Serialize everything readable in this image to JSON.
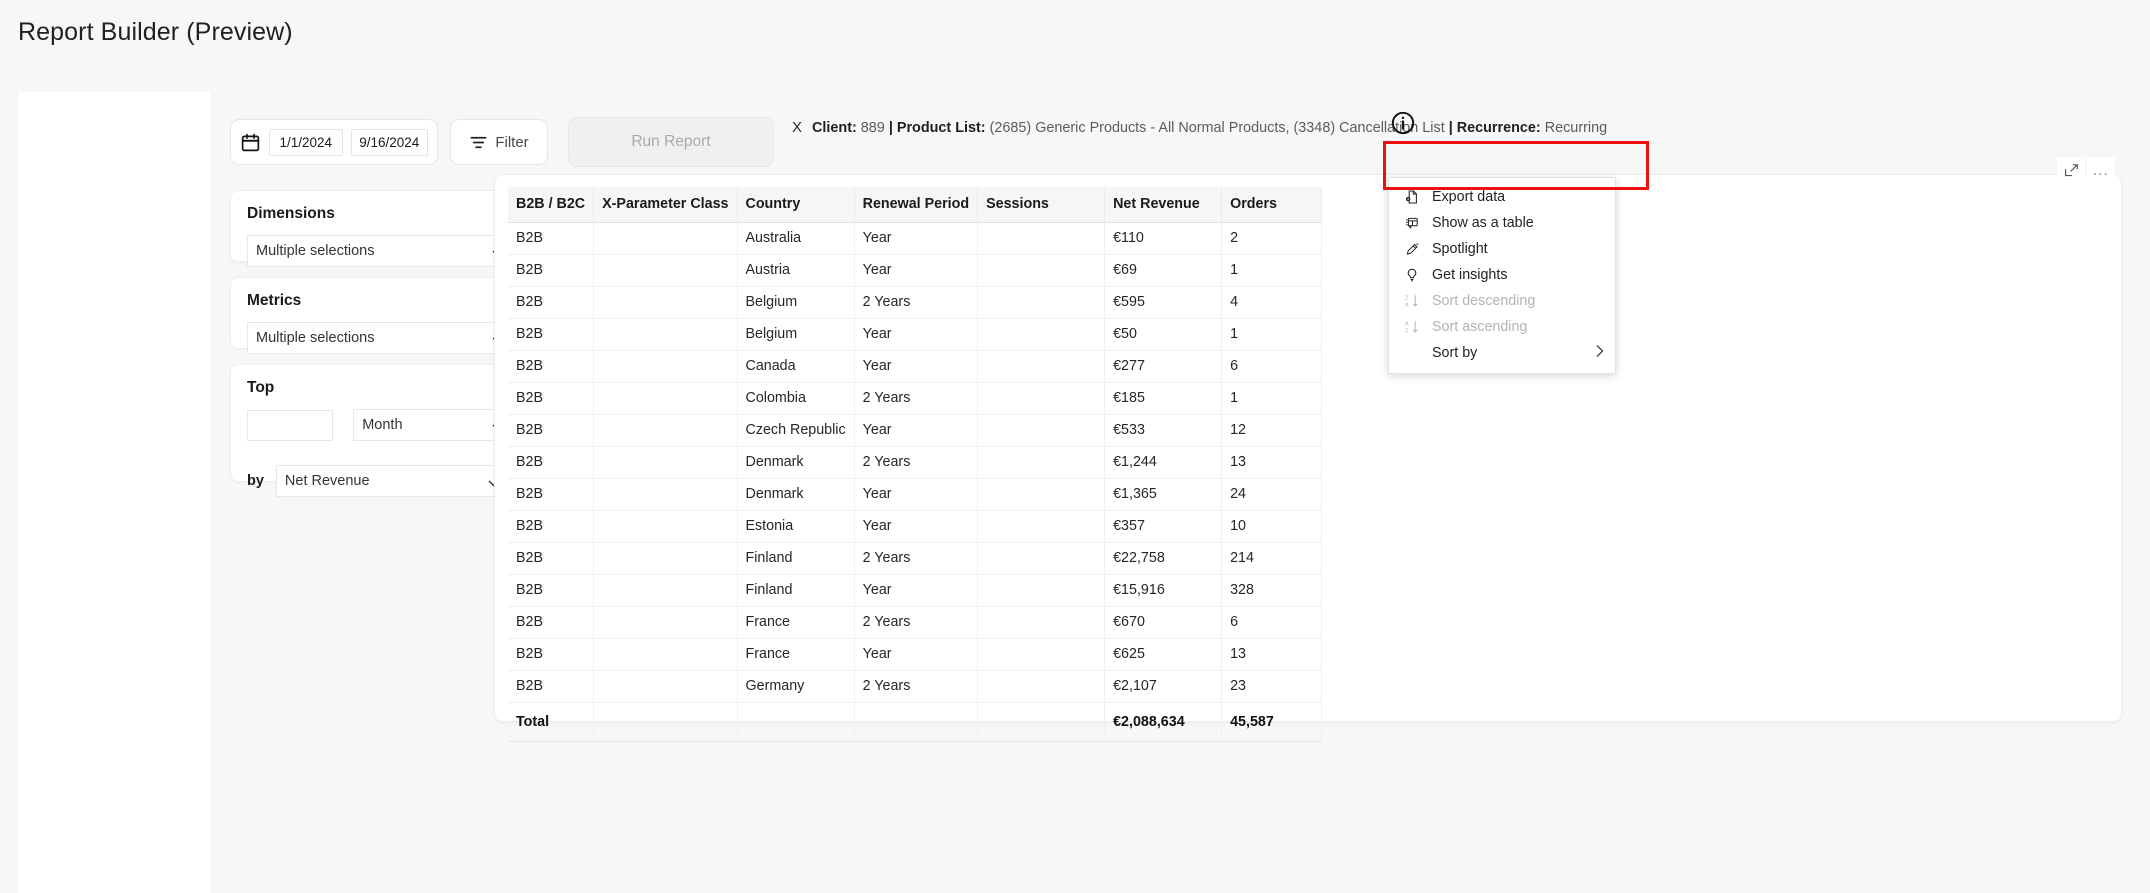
{
  "header": {
    "title": "Report Builder (Preview)"
  },
  "toolbar": {
    "calendar_icon": "calendar-icon",
    "date_from": "1/1/2024",
    "date_to": "9/16/2024",
    "filter_label": "Filter",
    "filter_icon": "filter-icon",
    "run_report_label": "Run Report",
    "info_icon": "info-circle-icon",
    "applied_filters": {
      "remove_label": "X",
      "client_label": "Client:",
      "client_value": "889",
      "sep1": "|",
      "product_list_label": "Product List:",
      "product_list_value": "(2685) Generic Products - All Normal Products, (3348) Cancellation List",
      "sep2": "|",
      "recurrence_label": "Recurrence:",
      "recurrence_value": "Recurring"
    }
  },
  "config": {
    "dimensions": {
      "title": "Dimensions",
      "value": "Multiple selections"
    },
    "metrics": {
      "title": "Metrics",
      "value": "Multiple selections"
    },
    "top": {
      "title": "Top",
      "count_value": "",
      "period_value": "Month",
      "by_label": "by",
      "by_value": "Net Revenue"
    }
  },
  "visual": {
    "focus_icon": "focus-mode-icon",
    "more_options_icon": "more-options-ellipsis-icon",
    "columns": [
      "B2B / B2C",
      "X-Parameter Class",
      "Country",
      "Renewal Period",
      "Sessions",
      "Net Revenue",
      "Orders"
    ],
    "rows": [
      [
        "B2B",
        "",
        "Australia",
        "Year",
        "",
        "€110",
        "2"
      ],
      [
        "B2B",
        "",
        "Austria",
        "Year",
        "",
        "€69",
        "1"
      ],
      [
        "B2B",
        "",
        "Belgium",
        "2 Years",
        "",
        "€595",
        "4"
      ],
      [
        "B2B",
        "",
        "Belgium",
        "Year",
        "",
        "€50",
        "1"
      ],
      [
        "B2B",
        "",
        "Canada",
        "Year",
        "",
        "€277",
        "6"
      ],
      [
        "B2B",
        "",
        "Colombia",
        "2 Years",
        "",
        "€185",
        "1"
      ],
      [
        "B2B",
        "",
        "Czech Republic",
        "Year",
        "",
        "€533",
        "12"
      ],
      [
        "B2B",
        "",
        "Denmark",
        "2 Years",
        "",
        "€1,244",
        "13"
      ],
      [
        "B2B",
        "",
        "Denmark",
        "Year",
        "",
        "€1,365",
        "24"
      ],
      [
        "B2B",
        "",
        "Estonia",
        "Year",
        "",
        "€357",
        "10"
      ],
      [
        "B2B",
        "",
        "Finland",
        "2 Years",
        "",
        "€22,758",
        "214"
      ],
      [
        "B2B",
        "",
        "Finland",
        "Year",
        "",
        "€15,916",
        "328"
      ],
      [
        "B2B",
        "",
        "France",
        "2 Years",
        "",
        "€670",
        "6"
      ],
      [
        "B2B",
        "",
        "France",
        "Year",
        "",
        "€625",
        "13"
      ],
      [
        "B2B",
        "",
        "Germany",
        "2 Years",
        "",
        "€2,107",
        "23"
      ]
    ],
    "total_row": [
      "Total",
      "",
      "",
      "",
      "",
      "€2,088,634",
      "45,587"
    ]
  },
  "context_menu": {
    "items": [
      {
        "label": "Export data",
        "icon": "export-data-icon",
        "disabled": false,
        "highlighted": true
      },
      {
        "label": "Show as a table",
        "icon": "show-as-table-icon",
        "disabled": false,
        "highlighted": false
      },
      {
        "label": "Spotlight",
        "icon": "spotlight-icon",
        "disabled": false,
        "highlighted": false
      },
      {
        "label": "Get insights",
        "icon": "lightbulb-icon",
        "disabled": false,
        "highlighted": false
      },
      {
        "label": "Sort descending",
        "icon": "sort-descending-icon",
        "disabled": true,
        "highlighted": false
      },
      {
        "label": "Sort ascending",
        "icon": "sort-ascending-icon",
        "disabled": true,
        "highlighted": false
      },
      {
        "label": "Sort by",
        "icon": "",
        "disabled": false,
        "highlighted": false,
        "submenu": true
      }
    ]
  },
  "colors": {
    "page_bg": "#f7f7f7",
    "card_bg": "#ffffff",
    "header_row_bg": "#f6f6f6",
    "highlight_red": "#ee1111",
    "disabled_text": "#b4b4b4",
    "muted_text": "#5c5c5c"
  }
}
